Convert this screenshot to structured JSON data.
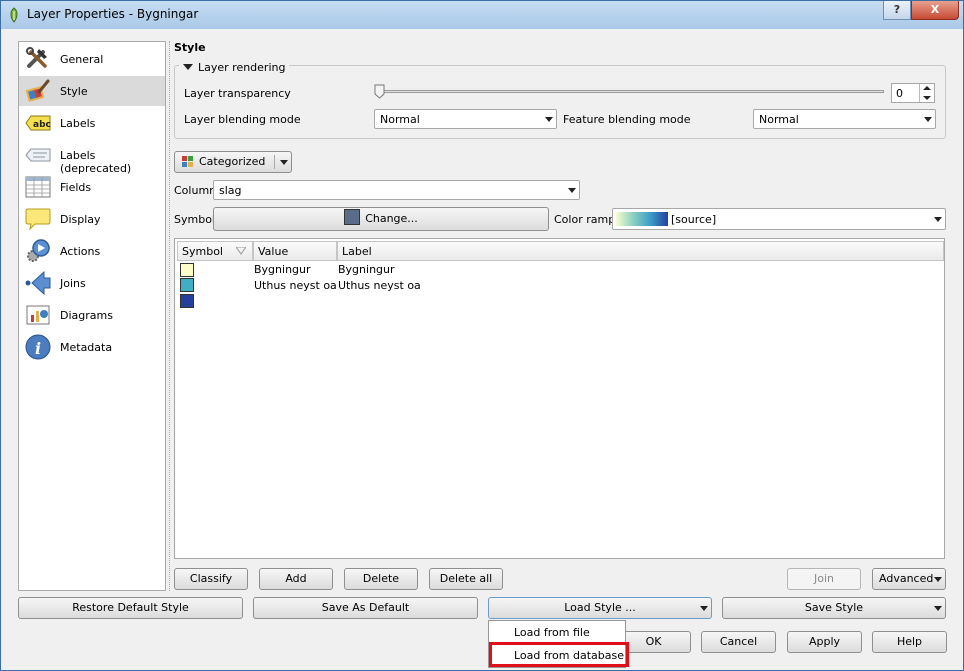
{
  "window": {
    "title": "Layer Properties - Bygningar",
    "help_button": "?",
    "close_button": "X"
  },
  "sidebar": {
    "items": [
      {
        "label": "General",
        "icon": "hammer-wrench-icon"
      },
      {
        "label": "Style",
        "icon": "paint-brush-icon"
      },
      {
        "label": "Labels",
        "icon": "abc-label-icon"
      },
      {
        "label": "Labels (deprecated)",
        "icon": "label-deprecated-icon"
      },
      {
        "label": "Fields",
        "icon": "table-fields-icon"
      },
      {
        "label": "Display",
        "icon": "speech-bubble-icon"
      },
      {
        "label": "Actions",
        "icon": "gear-play-icon"
      },
      {
        "label": "Joins",
        "icon": "arrow-join-icon"
      },
      {
        "label": "Diagrams",
        "icon": "diagram-icon"
      },
      {
        "label": "Metadata",
        "icon": "info-icon"
      }
    ],
    "selected": "Style"
  },
  "style_panel": {
    "title": "Style",
    "layer_rendering": {
      "legend": "Layer rendering",
      "transparency_label": "Layer transparency",
      "transparency_value": "0",
      "blending_label": "Layer blending mode",
      "blending_value": "Normal",
      "feature_blending_label": "Feature blending mode",
      "feature_blending_value": "Normal"
    },
    "renderer": "Categorized",
    "column_label": "Column",
    "column_value": "slag",
    "symbol_label": "Symbol",
    "change_button": "Change...",
    "symbol_color": "#5a6c88",
    "color_ramp_label": "Color ramp",
    "color_ramp_value": "[source]",
    "table": {
      "headers": [
        "Symbol",
        "Value",
        "Label"
      ],
      "rows": [
        {
          "color": "#fdfdc9",
          "value": "Bygningur",
          "label": "Bygningur"
        },
        {
          "color": "#3fb0c4",
          "value": "Uthus neyst oa",
          "label": "Uthus neyst oa"
        },
        {
          "color": "#24409a",
          "value": "",
          "label": ""
        }
      ]
    },
    "buttons": {
      "classify": "Classify",
      "add": "Add",
      "delete": "Delete",
      "delete_all": "Delete all",
      "join": "Join",
      "advanced": "Advanced"
    }
  },
  "bottom": {
    "restore_default": "Restore Default Style",
    "save_as_default": "Save As Default",
    "load_style": "Load Style ...",
    "save_style": "Save Style",
    "ok": "OK",
    "cancel": "Cancel",
    "apply": "Apply",
    "help": "Help"
  },
  "dropdown": {
    "items": [
      "Load from file",
      "Load from database"
    ],
    "highlighted": "Load from database"
  }
}
